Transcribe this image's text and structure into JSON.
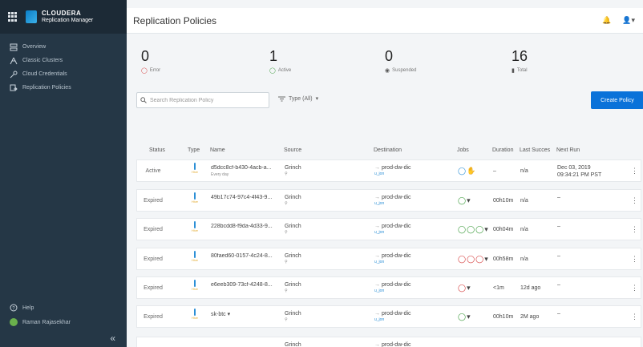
{
  "brand": {
    "name": "CLOUDERA",
    "product": "Replication Manager"
  },
  "sidebar": {
    "items": [
      {
        "label": "Overview",
        "icon": "overview-icon"
      },
      {
        "label": "Classic Clusters",
        "icon": "cluster-icon"
      },
      {
        "label": "Cloud Credentials",
        "icon": "key-icon"
      },
      {
        "label": "Replication Policies",
        "icon": "policies-icon"
      }
    ],
    "help": "Help",
    "user": "Raman Rajasekhar",
    "collapse": "«"
  },
  "header": {
    "title": "Replication Policies"
  },
  "stats": [
    {
      "value": "0",
      "label": "Error"
    },
    {
      "value": "1",
      "label": "Active"
    },
    {
      "value": "0",
      "label": "Suspended"
    },
    {
      "value": "16",
      "label": "Total"
    }
  ],
  "toolbar": {
    "search_placeholder": "Search Replication Policy",
    "type_filter": "Type (All)",
    "create_label": "Create Policy"
  },
  "table": {
    "headers": [
      "Status",
      "Type",
      "Name",
      "Source",
      "Destination",
      "Jobs",
      "Duration",
      "Last Succes",
      "Next Run"
    ],
    "rows": [
      {
        "status": "Active",
        "type": "Hive",
        "name": "d5dcc8cf-b430-4acb-a...",
        "sub": "Every day",
        "source": "Grinch",
        "dest": "prod-dw-dic",
        "dest_sub": "u_jon",
        "jobs": "running",
        "duration": "–",
        "last": "n/a",
        "next1": "Dec 03, 2019",
        "next2": "09:34:21 PM PST"
      },
      {
        "status": "Expired",
        "type": "Hive",
        "name": "49b17c74-97c4-4f43-9...",
        "sub": "",
        "source": "Grinch",
        "dest": "prod-dw-dic",
        "dest_sub": "u_jon",
        "jobs": "ok1",
        "duration": "00h10m",
        "last": "n/a",
        "next1": "–",
        "next2": ""
      },
      {
        "status": "Expired",
        "type": "Hive",
        "name": "228bcdd8-f9da-4d33-9...",
        "sub": "",
        "source": "Grinch",
        "dest": "prod-dw-dic",
        "dest_sub": "u_jon",
        "jobs": "ok3",
        "duration": "00h04m",
        "last": "n/a",
        "next1": "–",
        "next2": ""
      },
      {
        "status": "Expired",
        "type": "Hive",
        "name": "80faed60-0157-4c24-8...",
        "sub": "",
        "source": "Grinch",
        "dest": "prod-dw-dic",
        "dest_sub": "u_jon",
        "jobs": "err3",
        "duration": "00h58m",
        "last": "n/a",
        "next1": "–",
        "next2": ""
      },
      {
        "status": "Expired",
        "type": "Hive",
        "name": "e6eeb309-73cf-4248-8...",
        "sub": "",
        "source": "Grinch",
        "dest": "prod-dw-dic",
        "dest_sub": "u_jon",
        "jobs": "err1",
        "duration": "<1m",
        "last": "12d ago",
        "next1": "–",
        "next2": ""
      },
      {
        "status": "Expired",
        "type": "Hive",
        "name": "sk-btc ▾",
        "sub": "",
        "source": "Grinch",
        "dest": "prod-dw-dic",
        "dest_sub": "u_jon",
        "jobs": "ok1",
        "duration": "00h10m",
        "last": "2M ago",
        "next1": "–",
        "next2": ""
      },
      {
        "status": "",
        "type": "",
        "name": "",
        "sub": "",
        "source": "Grinch",
        "dest": "prod-dw-dic",
        "dest_sub": "",
        "jobs": "",
        "duration": "",
        "last": "",
        "next1": "",
        "next2": ""
      }
    ]
  }
}
